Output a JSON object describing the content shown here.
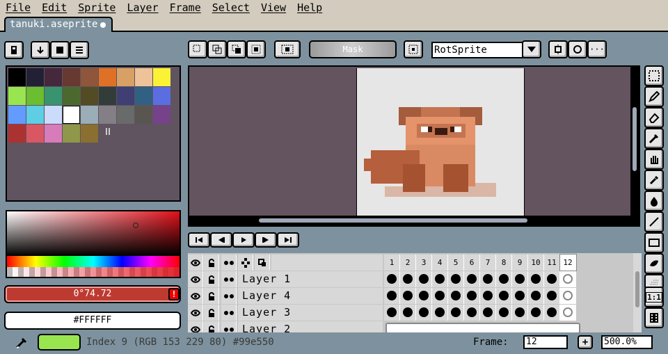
{
  "menu": [
    "File",
    "Edit",
    "Sprite",
    "Layer",
    "Frame",
    "Select",
    "View",
    "Help"
  ],
  "tab": {
    "title": "tanuki.aseprite"
  },
  "toolbar": {
    "mask_label": "Mask",
    "rotation_algorithm": "RotSprite"
  },
  "palette": {
    "colors": [
      "#000000",
      "#222034",
      "#45283c",
      "#663931",
      "#8f563b",
      "#df7126",
      "#d9a066",
      "#eec39a",
      "#fbf236",
      "#99e550",
      "#6abe30",
      "#37946e",
      "#4b692f",
      "#524b24",
      "#323c39",
      "#3f3f74",
      "#306082",
      "#5b6ee1",
      "#639bff",
      "#5fcde4",
      "#cbdbfc",
      "#ffffff",
      "#9badb7",
      "#847e87",
      "#696a6a",
      "#595652",
      "#76428a",
      "#ac3232",
      "#d95763",
      "#d77bba",
      "#8f974a",
      "#8a6f30"
    ]
  },
  "color_bar": {
    "bg_color_label": "0°74.72",
    "fg_color_label": "#FFFFFF",
    "current_color": "#99e550"
  },
  "timeline": {
    "frames": [
      "1",
      "2",
      "3",
      "4",
      "5",
      "6",
      "7",
      "8",
      "9",
      "10",
      "11",
      "12"
    ],
    "layers": [
      "Layer 1",
      "Layer 4",
      "Layer 3",
      "Layer 2"
    ]
  },
  "status": {
    "text": "Index 9 (RGB 153 229 80) #99e550",
    "frame_label": "Frame:",
    "frame_value": "12",
    "zoom_value": "500.0%"
  }
}
